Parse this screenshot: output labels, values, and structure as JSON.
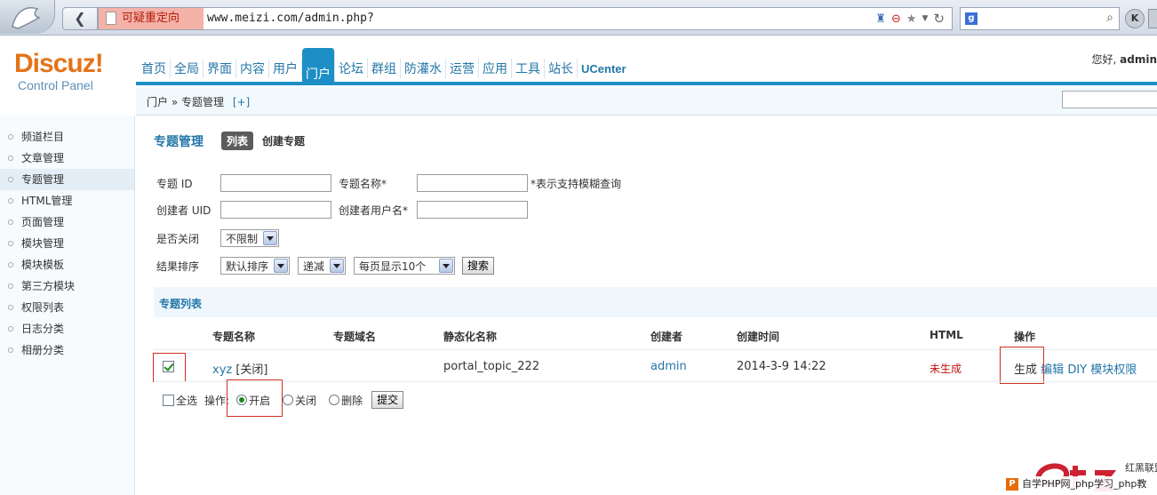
{
  "browser": {
    "redirect_warning": "可疑重定向",
    "url": "www.meizi.com/admin.php?"
  },
  "header": {
    "logo_main": "Discuz!",
    "logo_sub": "Control Panel",
    "greeting_prefix": "您好,",
    "username": "admin"
  },
  "nav": {
    "items": [
      "首页",
      "全局",
      "界面",
      "内容",
      "用户",
      "门户",
      "论坛",
      "群组",
      "防灌水",
      "运营",
      "应用",
      "工具",
      "站长",
      "UCenter"
    ],
    "active": "门户"
  },
  "breadcrumb": {
    "path": "门户 » 专题管理",
    "add": "[+]"
  },
  "sidebar": {
    "items": [
      {
        "label": "频道栏目"
      },
      {
        "label": "文章管理"
      },
      {
        "label": "专题管理"
      },
      {
        "label": "HTML管理"
      },
      {
        "label": "页面管理"
      },
      {
        "label": "模块管理"
      },
      {
        "label": "模块模板"
      },
      {
        "label": "第三方模块"
      },
      {
        "label": "权限列表"
      },
      {
        "label": "日志分类"
      },
      {
        "label": "相册分类"
      }
    ],
    "active_index": 2
  },
  "main": {
    "title": "专题管理",
    "tab_list": "列表",
    "tab_create": "创建专题"
  },
  "filter": {
    "topic_id_label": "专题 ID",
    "topic_name_label": "专题名称*",
    "fuzzy_hint": "*表示支持模糊查询",
    "creator_uid_label": "创建者 UID",
    "creator_name_label": "创建者用户名*",
    "closed_label": "是否关闭",
    "closed_value": "不限制",
    "sort_label": "结果排序",
    "sort_value": "默认排序",
    "order_value": "递减",
    "perpage_value": "每页显示10个",
    "search_button": "搜索"
  },
  "list": {
    "section_title": "专题列表",
    "columns": [
      "专题名称",
      "专题域名",
      "静态化名称",
      "创建者",
      "创建时间",
      "HTML",
      "操作"
    ],
    "rows": [
      {
        "name": "xyz",
        "status": "[关闭]",
        "domain": "",
        "static_name": "portal_topic_222",
        "creator": "admin",
        "created": "2014-3-9 14:22",
        "html": "未生成",
        "action_generate": "生成",
        "action_edit": "编辑",
        "action_diy": "DIY",
        "action_perm": "模块权限",
        "checked": true
      }
    ]
  },
  "bulk": {
    "select_all": "全选",
    "op_label": "操作:",
    "open": "开启",
    "close": "关闭",
    "delete": "删除",
    "submit": "提交",
    "selected": "开启"
  },
  "watermark": {
    "text": "自学PHP网_php学习_php教"
  },
  "colors": {
    "nav_blue": "#1d8fc6",
    "link_blue": "#2376a8",
    "logo_orange": "#e4741a",
    "warn_red": "#c0140c",
    "highlight_box": "#d03020"
  }
}
